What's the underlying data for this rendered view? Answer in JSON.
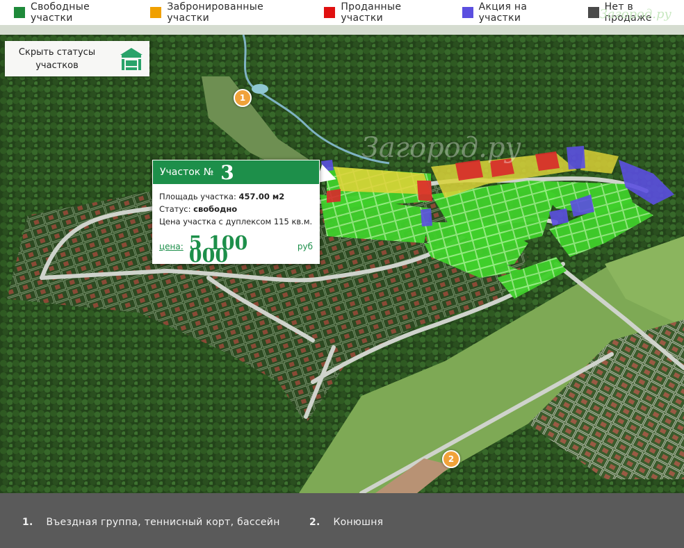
{
  "legend": [
    {
      "label": "Свободные участки",
      "color": "#1e8a3a"
    },
    {
      "label": "Забронированные участки",
      "color": "#f0a000"
    },
    {
      "label": "Проданные участки",
      "color": "#e01010"
    },
    {
      "label": "Акция на участки",
      "color": "#5b4fe0"
    },
    {
      "label": "Нет в продаже",
      "color": "#4a4a4a"
    }
  ],
  "site_logo": "Загород.ру",
  "watermark": "Загород.ру",
  "hide_button": {
    "line1": "Скрыть статусы",
    "line2": "участков",
    "icon": "house-gate-icon"
  },
  "markers": [
    "1",
    "2"
  ],
  "popup": {
    "title_label": "Участок №",
    "plot_number": "3",
    "area_label": "Площадь участка:",
    "area_value": "457.00 м2",
    "status_label": "Статус:",
    "status_value": "свободно",
    "description": "Цена участка с дуплексом 115 кв.м.",
    "price_label": "цена:",
    "price_value": "5 100 000",
    "currency": "руб"
  },
  "footer": [
    {
      "num": "1.",
      "text": "Въездная группа, теннисный корт, бассейн"
    },
    {
      "num": "2.",
      "text": "Конюшня"
    }
  ]
}
